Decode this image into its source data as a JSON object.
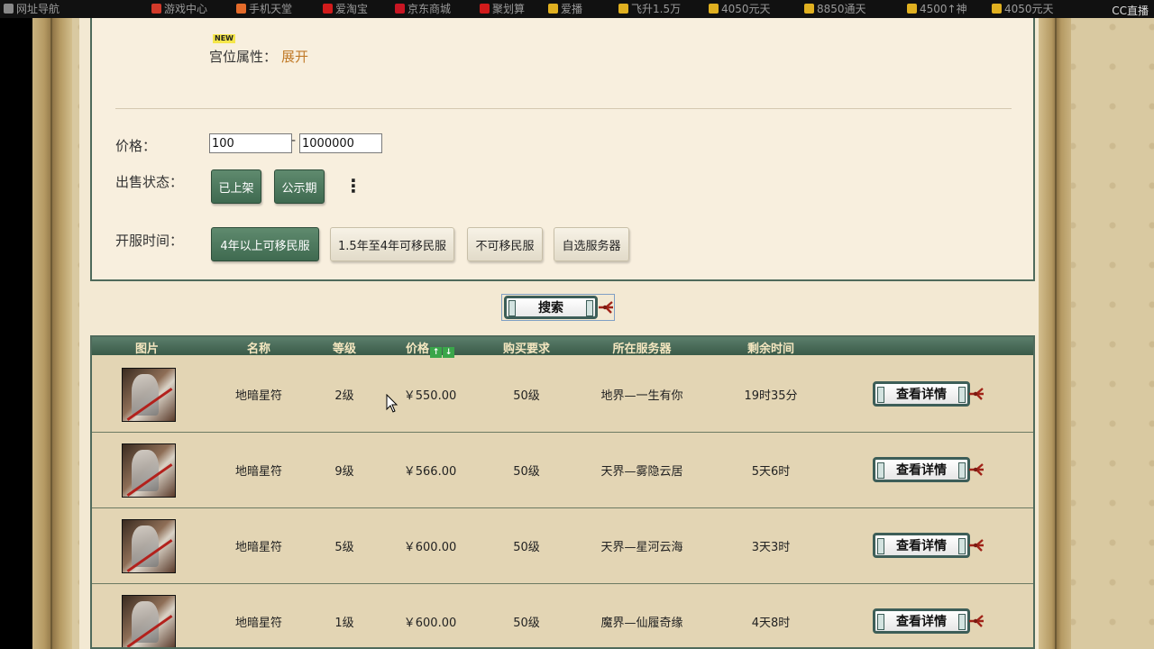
{
  "bookmarks": [
    {
      "label": "网址导航",
      "color": "#888888"
    },
    {
      "label": "游戏中心",
      "color": "#d23a2a"
    },
    {
      "label": "手机天堂",
      "color": "#e46b2a"
    },
    {
      "label": "爱淘宝",
      "color": "#d11b1b"
    },
    {
      "label": "京东商城",
      "color": "#c81623"
    },
    {
      "label": "聚划算",
      "color": "#d11b1b"
    },
    {
      "label": "爱播",
      "color": "#e0b020"
    },
    {
      "label": "飞升1.5万",
      "color": "#e0b020"
    },
    {
      "label": "4050元天",
      "color": "#e0b020"
    },
    {
      "label": "8850通天",
      "color": "#e0b020"
    },
    {
      "label": "4500↑神",
      "color": "#e0b020"
    },
    {
      "label": "4050元天",
      "color": "#e0b020"
    }
  ],
  "overlay_logo": "CC直播",
  "filters": {
    "new_badge": "NEW",
    "palace_label": "宫位属性：",
    "expand_link": "展开",
    "price_label": "价格：",
    "price_min": "100",
    "price_max": "1000000",
    "price_dash": "-",
    "sale_status_label": "出售状态：",
    "sale_status_options": [
      "已上架",
      "公示期"
    ],
    "server_time_label": "开服时间：",
    "server_time_options": [
      "4年以上可移民服",
      "1.5年至4年可移民服",
      "不可移民服",
      "自选服务器"
    ]
  },
  "search_button": "搜索",
  "table": {
    "headers": [
      "图片",
      "名称",
      "等级",
      "价格",
      "购买要求",
      "所在服务器",
      "剩余时间"
    ],
    "sort_up": "↑",
    "sort_down": "↓",
    "detail_label": "查看详情",
    "rows": [
      {
        "name": "地暗星符",
        "level": "2级",
        "price": "￥550.00",
        "requirement": "50级",
        "server": "地界—一生有你",
        "remaining": "19时35分"
      },
      {
        "name": "地暗星符",
        "level": "9级",
        "price": "￥566.00",
        "requirement": "50级",
        "server": "天界—雾隐云居",
        "remaining": "5天6时"
      },
      {
        "name": "地暗星符",
        "level": "5级",
        "price": "￥600.00",
        "requirement": "50级",
        "server": "天界—星河云海",
        "remaining": "3天3时"
      },
      {
        "name": "地暗星符",
        "level": "1级",
        "price": "￥600.00",
        "requirement": "50级",
        "server": "魔界—仙履奇缘",
        "remaining": "4天8时"
      }
    ]
  },
  "colors": {
    "panel_border": "#4f6a5b",
    "header_bg": "#3a5a48",
    "link": "#c07a28",
    "active_button": "#4f7a5e"
  }
}
